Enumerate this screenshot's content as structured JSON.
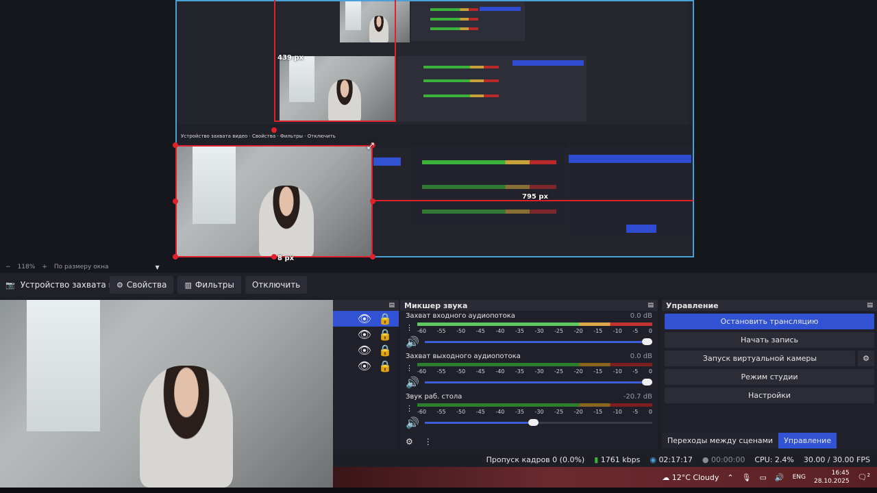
{
  "preview": {
    "px_label_top": "439 px",
    "px_label_right": "795 px",
    "px_label_bottom": "8 px"
  },
  "zoom_bar": {
    "minus": "−",
    "zoom": "118%",
    "plus": "+",
    "fit": "По размеру окна",
    "dropdown_icon": "caret-down-icon"
  },
  "source_toolbar": {
    "source_name": "Устройство захвата видео",
    "properties": "Свойства",
    "filters": "Фильтры",
    "disable": "Отключить"
  },
  "scenes": {
    "rows": 4,
    "icons": [
      "eye-icon",
      "lock-icon"
    ]
  },
  "mixer": {
    "title": "Микшер звука",
    "ticks": [
      "-60",
      "-55",
      "-50",
      "-45",
      "-40",
      "-35",
      "-30",
      "-25",
      "-20",
      "-15",
      "-10",
      "-5",
      "0"
    ],
    "channels": [
      {
        "name": "Захват входного аудиопотока",
        "db": "0.0 dB",
        "level": 0.98,
        "volume": 1.0
      },
      {
        "name": "Захват выходного аудиопотока",
        "db": "0.0 dB",
        "level": 0.0,
        "volume": 1.0
      },
      {
        "name": "Звук раб. стола",
        "db": "-20.7 dB",
        "level": 0.0,
        "volume": 0.5
      }
    ]
  },
  "controls": {
    "title": "Управление",
    "stop_stream": "Остановить трансляцию",
    "start_record": "Начать запись",
    "virtual_cam": "Запуск виртуальной камеры",
    "studio_mode": "Режим студии",
    "settings": "Настройки",
    "tab_transitions": "Переходы между сценами",
    "tab_controls": "Управление"
  },
  "status": {
    "dropped": "Пропуск кадров 0 (0.0%)",
    "bitrate": "1761 kbps",
    "stream_time": "02:17:17",
    "rec_time": "00:00:00",
    "cpu": "CPU: 2.4%",
    "fps": "30.00 / 30.00 FPS"
  },
  "taskbar": {
    "weather": "12°C  Cloudy",
    "lang": "ENG",
    "time": "16:45",
    "date": "28.10.2025",
    "notif_count": "2"
  },
  "colors": {
    "accent": "#3052d3",
    "record_red": "#e0202a",
    "canvas_border": "#4aa0d8"
  }
}
